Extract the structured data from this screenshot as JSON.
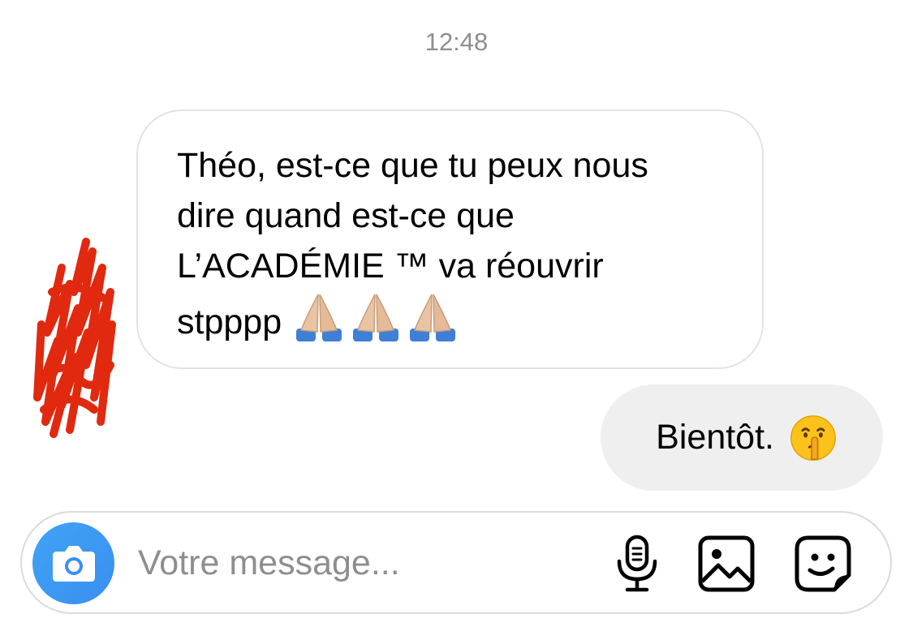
{
  "chat": {
    "timestamp": "12:48",
    "incoming": {
      "lines": [
        "Théo, est-ce que tu peux nous",
        "dire quand est-ce que",
        "L’ACADÉMIE ™ va réouvrir",
        "stpppp"
      ],
      "emoji": [
        "folded-hands",
        "folded-hands",
        "folded-hands"
      ]
    },
    "outgoing": {
      "text": "Bientôt.",
      "emoji": "shushing-face"
    }
  },
  "composer": {
    "placeholder": "Votre message...",
    "icons": [
      "camera-icon",
      "microphone-icon",
      "gallery-icon",
      "sticker-icon"
    ],
    "camera_color": "#3a8ef0"
  },
  "colors": {
    "incoming_border": "#e3e3e3",
    "outgoing_bg": "#efefef",
    "timestamp": "#8e8e8e",
    "avatar_scribble": "#e0290f"
  }
}
